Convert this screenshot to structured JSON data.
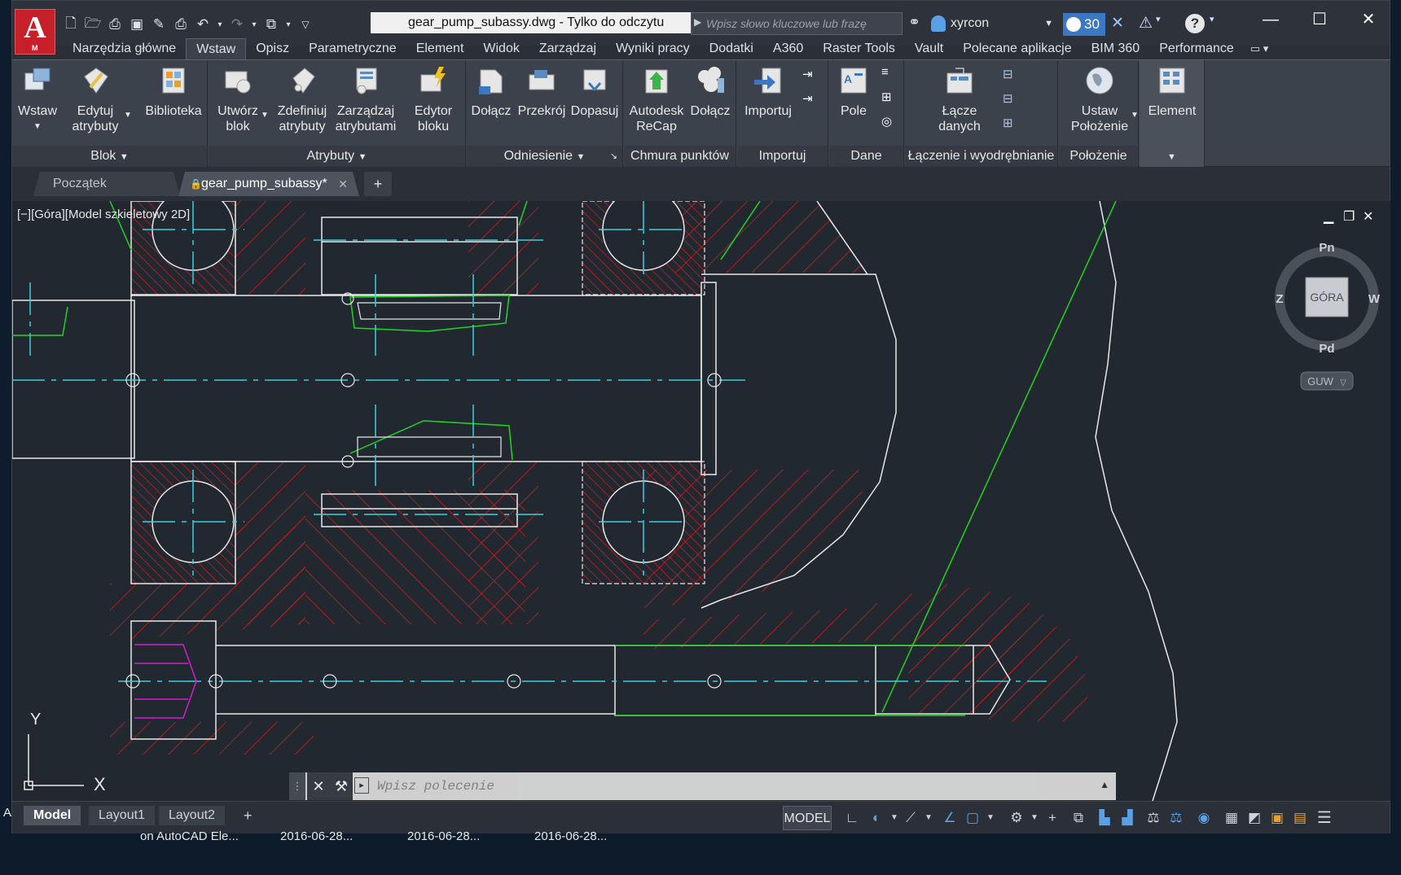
{
  "app": {
    "document_title": "gear_pump_subassy.dwg - Tylko do odczytu",
    "logo_letter": "A",
    "logo_sub": "M"
  },
  "search": {
    "placeholder": "Wpisz słowo kluczowe lub frazę"
  },
  "user": {
    "name": "xyrcon"
  },
  "badge": {
    "count": "30"
  },
  "window_controls": {
    "minimize": "—",
    "maximize": "☐",
    "close": "✕"
  },
  "ribbon_tabs": [
    "Narzędzia główne",
    "Wstaw",
    "Opisz",
    "Parametryczne",
    "Element",
    "Widok",
    "Zarządzaj",
    "Wyniki pracy",
    "Dodatki",
    "A360",
    "Raster Tools",
    "Vault",
    "Polecane aplikacje",
    "BIM 360",
    "Performance"
  ],
  "active_tab": "Wstaw",
  "panels": {
    "blok": {
      "title": "Blok",
      "tools": [
        "Wstaw",
        "Edytuj atrybuty",
        "Biblioteka"
      ]
    },
    "atrybuty": {
      "title": "Atrybuty",
      "tools": [
        "Utwórz blok",
        "Zdefiniuj atrybuty",
        "Zarządzaj atrybutami",
        "Edytor bloku"
      ]
    },
    "odniesienie": {
      "title": "Odniesienie",
      "tools": [
        "Dołącz",
        "Przekrój",
        "Dopasuj"
      ]
    },
    "chmura": {
      "title": "Chmura punktów",
      "tools": [
        "Autodesk ReCap",
        "Dołącz"
      ]
    },
    "importuj": {
      "title": "Importuj",
      "tools": [
        "Importuj"
      ]
    },
    "dane": {
      "title": "Dane",
      "tools": [
        "Pole"
      ]
    },
    "laczenie": {
      "title": "Łączenie i wyodrębnianie",
      "tools": [
        "Łącze danych"
      ]
    },
    "polozenie": {
      "title": "Położenie",
      "tools": [
        "Ustaw Położenie"
      ]
    },
    "element": {
      "title": "",
      "tools": [
        "Element"
      ]
    }
  },
  "tool_labels": {
    "wstaw": [
      "Wstaw"
    ],
    "edytuj": [
      "Edytuj",
      "atrybuty"
    ],
    "biblioteka": [
      "Biblioteka"
    ],
    "utworz": [
      "Utwórz",
      "blok"
    ],
    "zdefiniuj": [
      "Zdefiniuj",
      "atrybuty"
    ],
    "zarzadzaj": [
      "Zarządzaj",
      "atrybutami"
    ],
    "edytor": [
      "Edytor",
      "bloku"
    ],
    "dolacz1": [
      "Dołącz"
    ],
    "przekroj": [
      "Przekrój"
    ],
    "dopasuj": [
      "Dopasuj"
    ],
    "recap": [
      "Autodesk",
      "ReCap"
    ],
    "dolacz2": [
      "Dołącz"
    ],
    "importuj": [
      "Importuj"
    ],
    "pole": [
      "Pole"
    ],
    "lacze": [
      "Łącze",
      "danych"
    ],
    "ustaw": [
      "Ustaw",
      "Położenie"
    ],
    "element": [
      "Element"
    ]
  },
  "file_tabs": [
    "Początek",
    "gear_pump_subassy*"
  ],
  "viewport": {
    "label": "[−][Góra][Model szkieletowy 2D]",
    "viewcube": {
      "top": "GÓRA",
      "north": "Pn",
      "south": "Pd",
      "east": "W",
      "west": "Z",
      "ucs": "GUW"
    },
    "axis_x": "X",
    "axis_y": "Y"
  },
  "command": {
    "placeholder": "Wpisz polecenie"
  },
  "layout_tabs": [
    "Model",
    "Layout1",
    "Layout2"
  ],
  "status": {
    "model": "MODEL"
  },
  "taskbar": {
    "items": [
      "on AutoCAD Ele...",
      "2016-06-28...",
      "2016-06-28...",
      "2016-06-28..."
    ],
    "left_letter": "A"
  },
  "colors": {
    "hatch": "#e01d1d",
    "center": "#3fd0e0",
    "outline": "#e8e8e8",
    "dim": "#22d422",
    "accent": "#3a78c4"
  }
}
